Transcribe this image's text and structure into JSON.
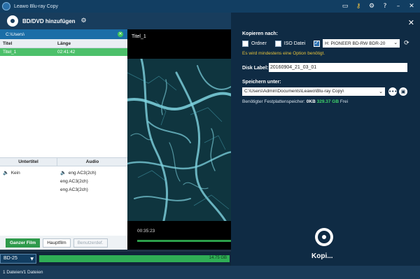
{
  "titlebar": {
    "title": "Leawo Blu-ray Copy",
    "icons": [
      "monitor-icon",
      "key-icon",
      "gear-icon",
      "help-icon",
      "minimize-icon",
      "close-icon"
    ]
  },
  "toolbar": {
    "add_label": "BD/DVD hinzufügen"
  },
  "left": {
    "path": "C:\\Users\\",
    "columns": [
      "Titel",
      "Länge"
    ],
    "rows": [
      {
        "title": "Titel_1",
        "length": "02:41:42"
      }
    ],
    "subtitle_header": "Untertitel",
    "audio_header": "Audio",
    "subtitles": [
      "Kein"
    ],
    "audio": [
      "eng AC3(2ch)",
      "eng AC3(2ch)",
      "eng AC3(2ch)"
    ],
    "modes": {
      "full": "Ganzer Film",
      "main": "Hauptfilm",
      "custom": "Benutzerdef."
    }
  },
  "video": {
    "title": "Titel_1",
    "time": "00:35:23"
  },
  "right": {
    "copy_to_label": "Kopieren nach:",
    "folder_label": "Ordner",
    "iso_label": "ISO Datei",
    "drive": "H: PIONEER  BD-RW   BDR-20",
    "warning": "Es wird mindestens eine Option benötigt.",
    "disk_label_label": "Disk Label:",
    "disk_label_value": "20160904_21_03_01",
    "save_to_label": "Speichern unter:",
    "save_path": "C:\\Users\\Admin\\Documents\\Leawo\\Blu-ray Copy\\",
    "space_prefix": "Benötigter Festplattenspeicher:",
    "space_required": "0KB",
    "space_free": "329.37 GB",
    "space_suffix": "Frei",
    "copy_label": "Kopi..."
  },
  "discbar": {
    "disc_type": "BD-25",
    "capacity": "14.75 GB"
  },
  "status": {
    "text": "1 Dateien/1 Dateien"
  },
  "colors": {
    "accent_green": "#2fae55",
    "panel_dark": "#0f2b44",
    "title_blue": "#123e62"
  }
}
